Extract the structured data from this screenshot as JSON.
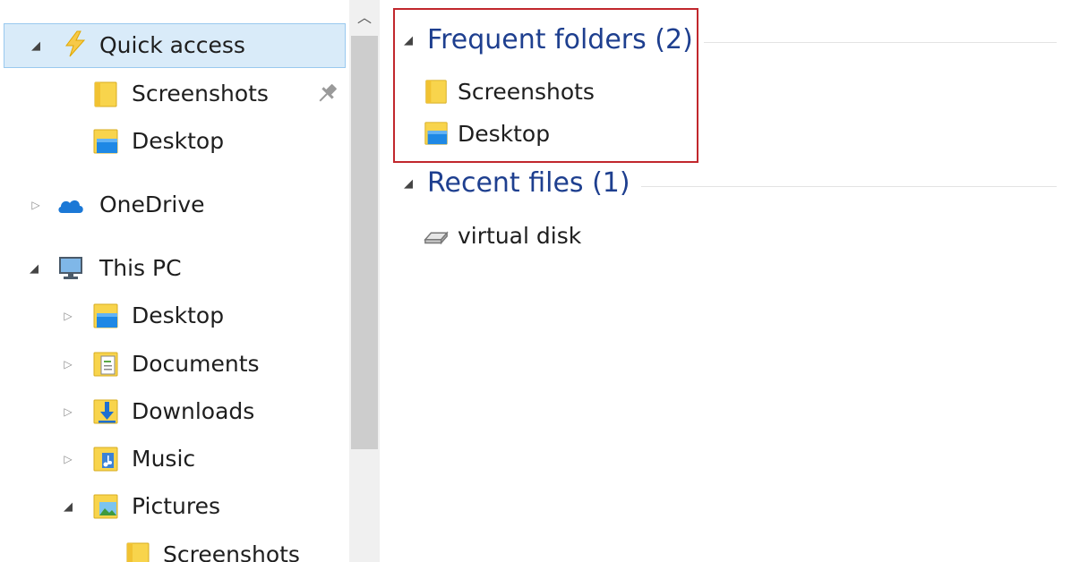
{
  "nav": {
    "quick_access": {
      "label": "Quick access",
      "expanded": true,
      "selected": true
    },
    "quick_items": [
      {
        "label": "Screenshots",
        "pinned": true,
        "icon": "folder-icon"
      },
      {
        "label": "Desktop",
        "icon": "desktop-folder-icon"
      }
    ],
    "onedrive": {
      "label": "OneDrive",
      "expanded": false
    },
    "this_pc": {
      "label": "This PC",
      "expanded": true,
      "children": [
        {
          "label": "Desktop",
          "icon": "desktop-folder-icon",
          "expanded": false
        },
        {
          "label": "Documents",
          "icon": "documents-folder-icon",
          "expanded": false
        },
        {
          "label": "Downloads",
          "icon": "downloads-folder-icon",
          "expanded": false
        },
        {
          "label": "Music",
          "icon": "music-folder-icon",
          "expanded": false
        },
        {
          "label": "Pictures",
          "icon": "pictures-folder-icon",
          "expanded": true
        }
      ],
      "pictures_children": [
        {
          "label": "Screenshots",
          "icon": "folder-icon"
        }
      ]
    }
  },
  "content": {
    "frequent": {
      "title": "Frequent folders (2)",
      "items": [
        {
          "label": "Screenshots",
          "icon": "folder-icon"
        },
        {
          "label": "Desktop",
          "icon": "desktop-folder-icon"
        }
      ]
    },
    "recent": {
      "title": "Recent files (1)",
      "items": [
        {
          "label": "virtual disk",
          "icon": "virtual-disk-icon"
        }
      ]
    }
  },
  "colors": {
    "selection_bg": "#d9ebf9",
    "selection_border": "#99c9ef",
    "group_title": "#1e3f8f",
    "highlight_box": "#c1272d",
    "folder_yellow": "#f8d44c"
  }
}
